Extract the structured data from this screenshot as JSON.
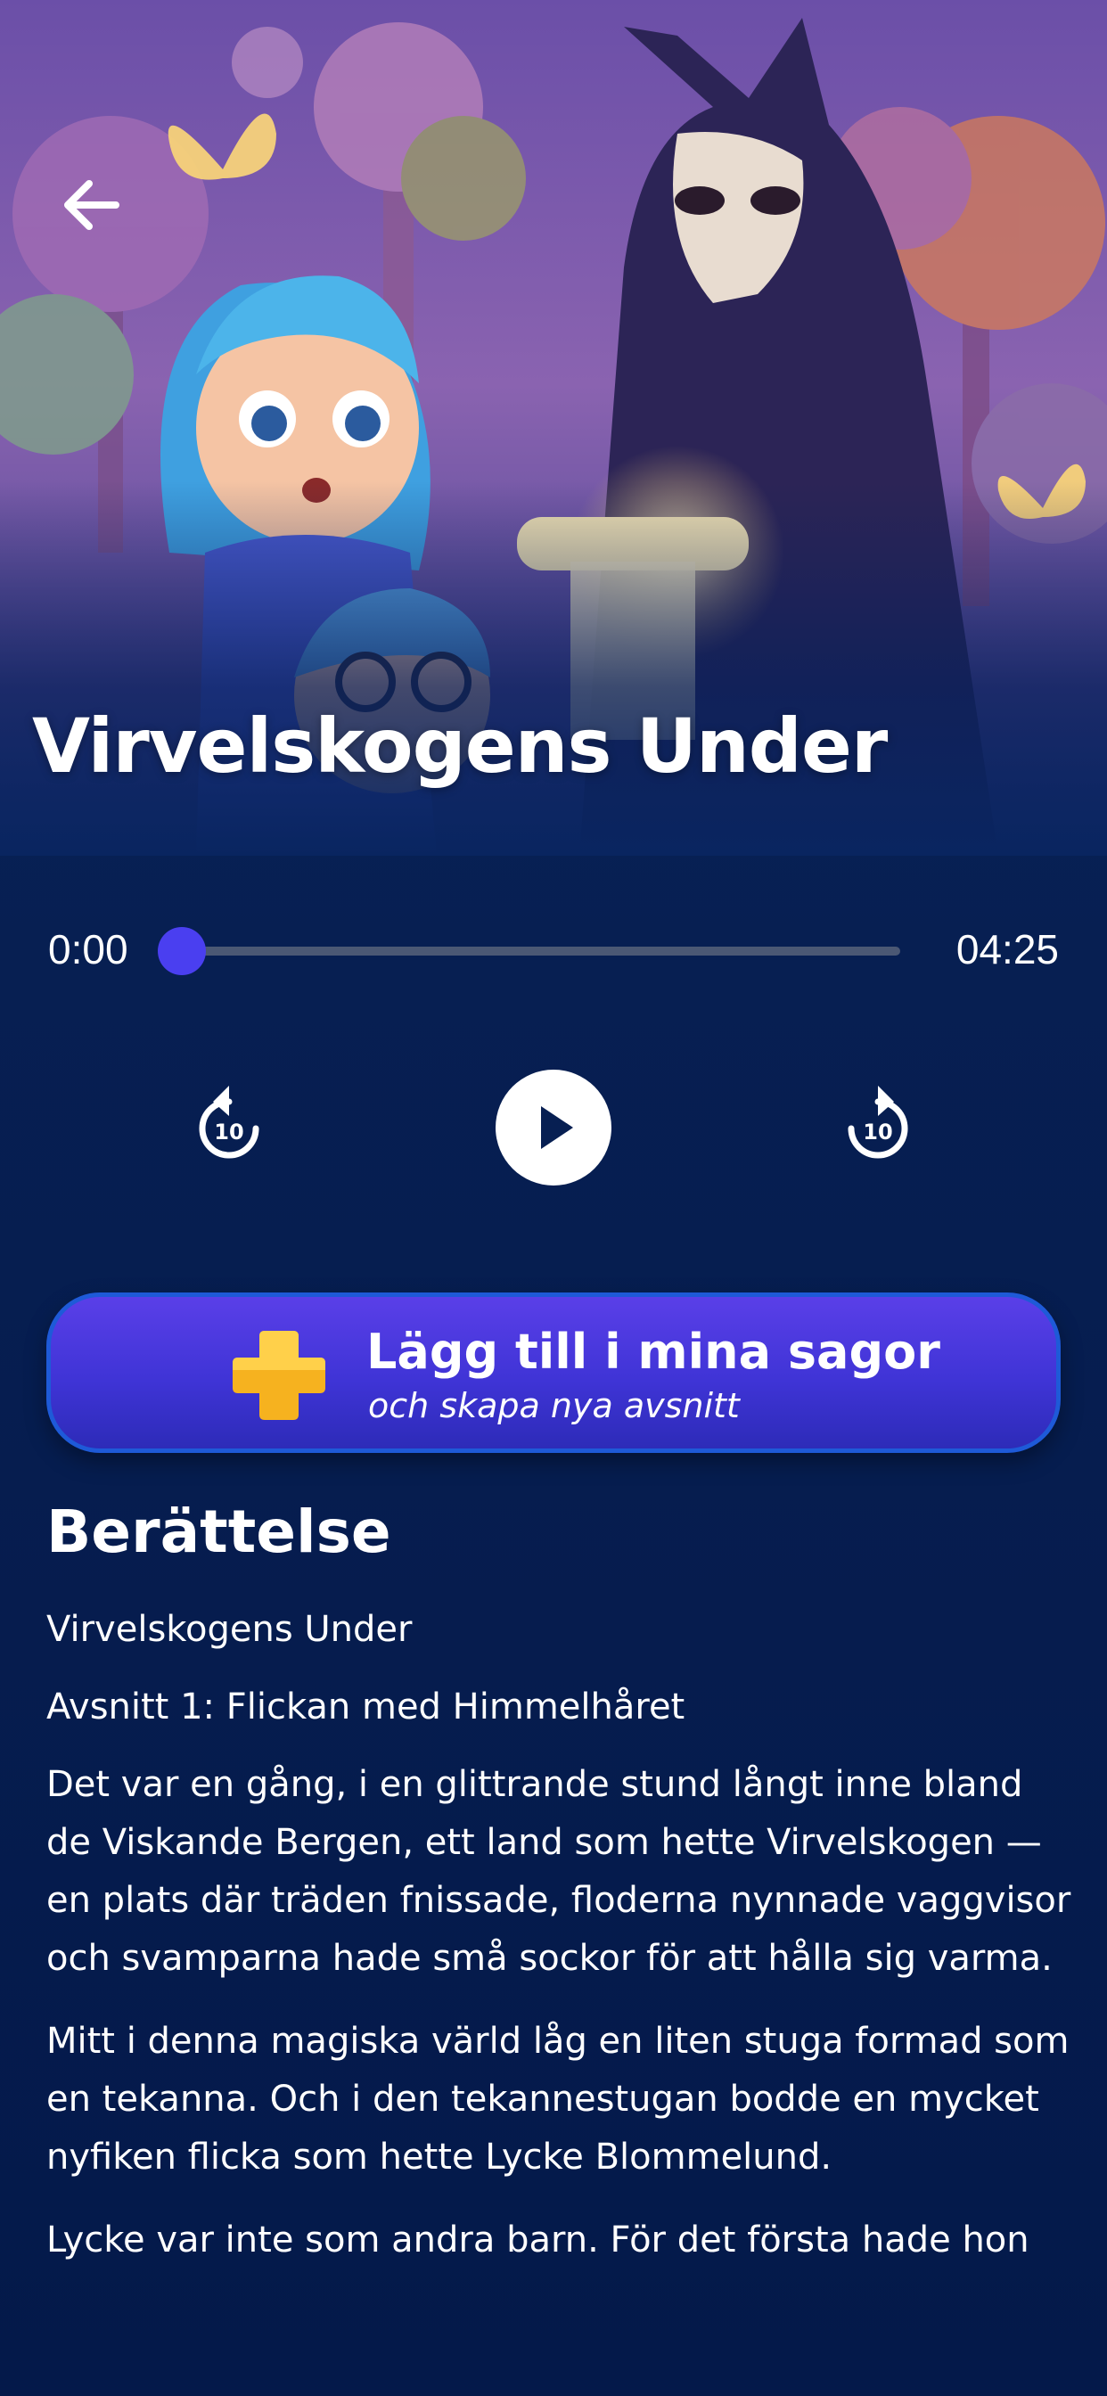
{
  "header": {
    "title": "Virvelskogens Under"
  },
  "player": {
    "current_time": "0:00",
    "total_time": "04:25",
    "progress": 0,
    "rewind_seconds": "10",
    "forward_seconds": "10"
  },
  "add_button": {
    "title": "Lägg till i mina sagor",
    "subtitle": "och skapa nya avsnitt"
  },
  "story": {
    "heading": "Berättelse",
    "paragraphs": [
      "Virvelskogens Under",
      "Avsnitt 1: Flickan med Himmelhåret",
      "Det var en gång, i en glittrande stund långt inne bland de Viskande Bergen, ett land som hette Virvelskogen — en plats där träden fnissade, floderna nynnade vaggvisor och svamparna hade små sockor för att hålla sig varma.",
      "Mitt i denna magiska värld låg en liten stuga formad som en tekanna. Och i den tekannestugan bodde en mycket nyfiken flicka som hette Lycke Blommelund.",
      "Lycke var inte som andra barn. För det första hade hon"
    ]
  },
  "icons": {
    "back": "arrow-left-icon",
    "rewind": "replay-10-icon",
    "play": "play-icon",
    "forward": "forward-10-icon",
    "add": "plus-icon"
  },
  "colors": {
    "background": "#071f52",
    "accent": "#4a3ff0",
    "plus": "#f6b21f"
  }
}
